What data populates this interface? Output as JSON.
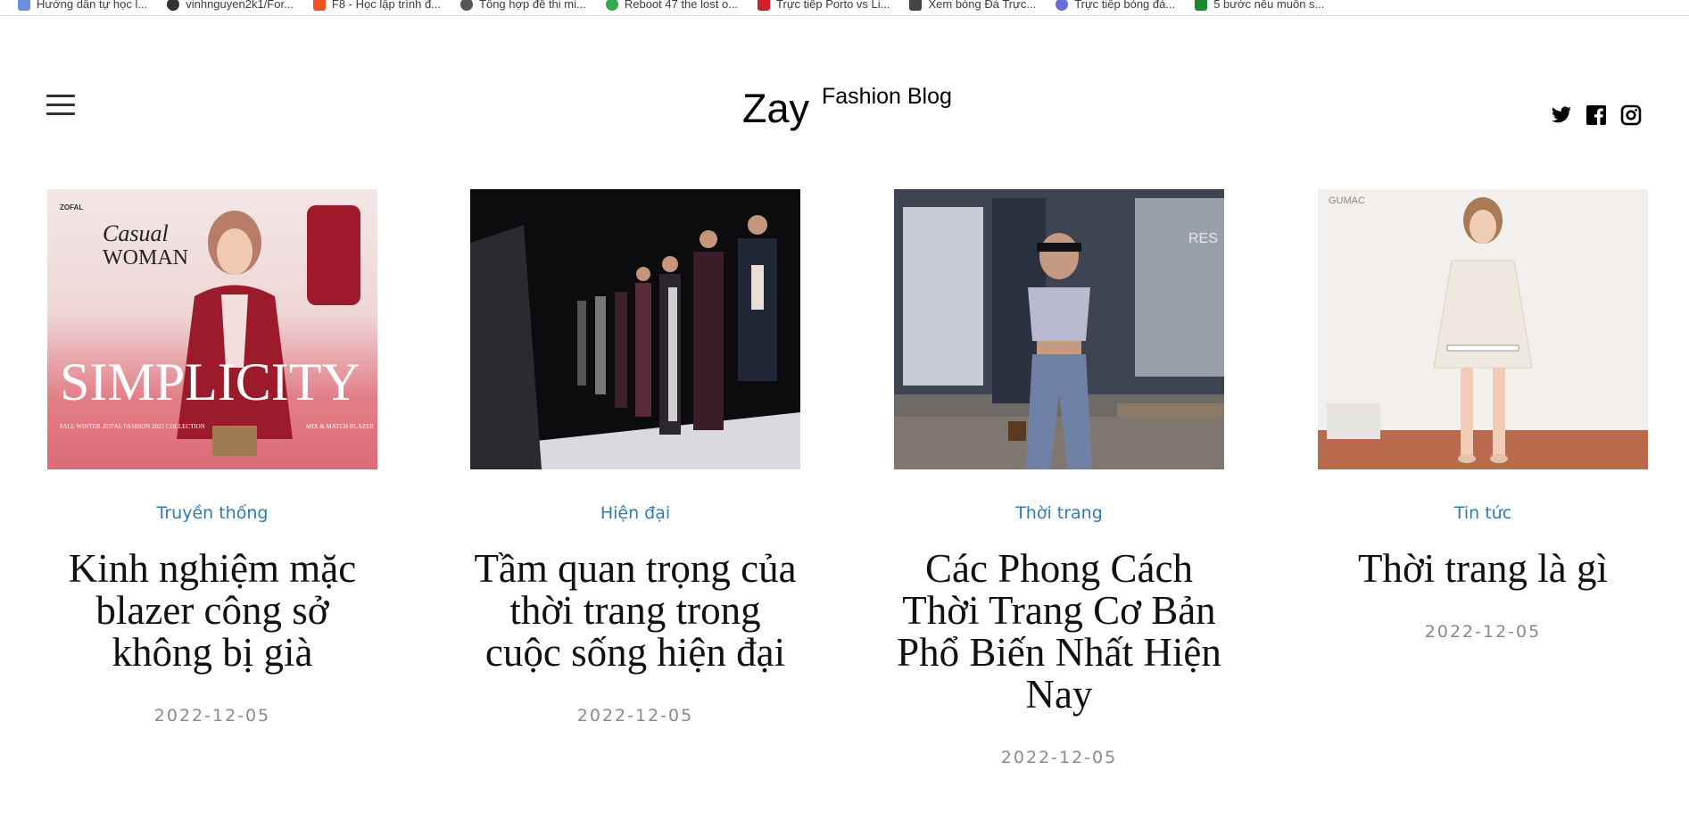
{
  "bookmarks": [
    {
      "label": "Hướng dẫn tự học l...",
      "icon": "doc-icon",
      "color": "#6a8fd8"
    },
    {
      "label": "vinhnguyen2k1/For...",
      "icon": "github-icon",
      "color": "#333333"
    },
    {
      "label": "F8 - Học lập trình đ...",
      "icon": "f8-icon",
      "color": "#f05123"
    },
    {
      "label": "Tổng hợp đề thi mi...",
      "icon": "globe-icon",
      "color": "#555555"
    },
    {
      "label": "Reboot 47 the lost o...",
      "icon": "google-icon",
      "color": "#34a853"
    },
    {
      "label": "Trực tiếp Porto vs Li...",
      "icon": "flag-icon",
      "color": "#d0202a"
    },
    {
      "label": "Xem bóng Đá Trực...",
      "icon": "page-icon",
      "color": "#444444"
    },
    {
      "label": "Trực tiếp bóng đá...",
      "icon": "ball-icon",
      "color": "#6c6cd8"
    },
    {
      "label": "5 bước nếu muốn s...",
      "icon": "check-icon",
      "color": "#1a8a2a"
    }
  ],
  "header": {
    "brand_main": "Zay",
    "brand_sub": "Fashion Blog",
    "menu_icon": "hamburger-menu-icon",
    "social": [
      "twitter-icon",
      "facebook-icon",
      "instagram-icon"
    ]
  },
  "posts": [
    {
      "category": "Truyền thống",
      "title": "Kinh nghiệm mặc blazer công sở không bị già",
      "date": "2022-12-05",
      "image": "blazer-poster-image"
    },
    {
      "category": "Hiện đại",
      "title": "Tầm quan trọng của thời trang trong cuộc sống hiện đại",
      "date": "2022-12-05",
      "image": "runway-image"
    },
    {
      "category": "Thời trang",
      "title": "Các Phong Cách Thời Trang Cơ Bản Phổ Biến Nhất Hiện Nay",
      "date": "2022-12-05",
      "image": "street-style-image"
    },
    {
      "category": "Tin tức",
      "title": "Thời trang là gì",
      "date": "2022-12-05",
      "image": "dress-model-image"
    }
  ],
  "poster": {
    "brand": "ZOFAL",
    "script": "Casual",
    "headline": "WOMAN",
    "big_word": "SIMPLICITY",
    "footer_left": "FALL WINTER",
    "footer_mid": "ZOFAL FASHION 2022 COLLECTION",
    "footer_right": "MIX & MATCH BLAZER"
  },
  "dress_brand": "GUMAC",
  "storefront_text": "RES",
  "colors": {
    "accent": "#2f7ab8",
    "title": "#111111",
    "date": "#8a8a8a"
  }
}
